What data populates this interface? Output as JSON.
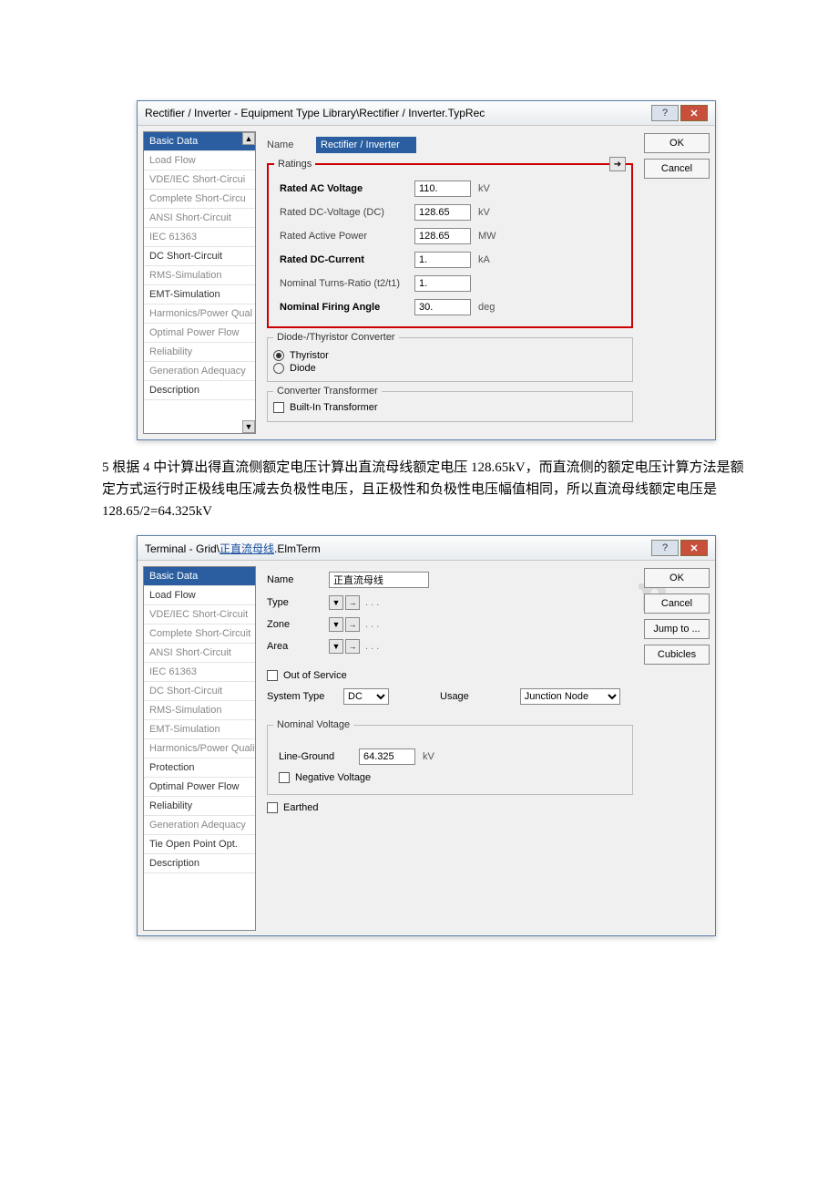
{
  "dialog1": {
    "title": "Rectifier / Inverter - Equipment Type Library\\Rectifier / Inverter.TypRec",
    "sidebar": [
      "Basic Data",
      "Load Flow",
      "VDE/IEC Short-Circui",
      "Complete Short-Circu",
      "ANSI Short-Circuit",
      "IEC 61363",
      "DC Short-Circuit",
      "RMS-Simulation",
      "EMT-Simulation",
      "Harmonics/Power Qual",
      "Optimal Power Flow",
      "Reliability",
      "Generation Adequacy",
      "Description"
    ],
    "name_label": "Name",
    "name_value": "Rectifier / Inverter",
    "ratings_legend": "Ratings",
    "ratings": [
      {
        "label": "Rated AC Voltage",
        "value": "110.",
        "unit": "kV",
        "hl": true
      },
      {
        "label": "Rated DC-Voltage (DC)",
        "value": "128.65",
        "unit": "kV",
        "hl": false
      },
      {
        "label": "Rated Active Power",
        "value": "128.65",
        "unit": "MW",
        "hl": false
      },
      {
        "label": "Rated DC-Current",
        "value": "1.",
        "unit": "kA",
        "hl": true
      },
      {
        "label": "Nominal Turns-Ratio (t2/t1)",
        "value": "1.",
        "unit": "",
        "hl": false
      },
      {
        "label": "Nominal Firing Angle",
        "value": "30.",
        "unit": "deg",
        "hl": true
      }
    ],
    "conv_legend": "Diode-/Thyristor Converter",
    "conv_opt1": "Thyristor",
    "conv_opt2": "Diode",
    "xfmr_legend": "Converter Transformer",
    "xfmr_check": "Built-In Transformer",
    "buttons": {
      "ok": "OK",
      "cancel": "Cancel"
    }
  },
  "doctext": "5 根据 4 中计算出得直流侧额定电压计算出直流母线额定电压 128.65kV，而直流侧的额定电压计算方法是额定方式运行时正极线电压减去负极性电压，且正极性和负极性电压幅值相同，所以直流母线额定电压是 128.65/2=64.325kV",
  "dialog2": {
    "title_pre": "Terminal - Grid\\",
    "title_link": "正直流母线",
    "title_post": ".ElmTerm",
    "watermark": "WWW.docx.com",
    "sidebar": [
      "Basic Data",
      "Load Flow",
      "VDE/IEC Short-Circuit",
      "Complete Short-Circuit",
      "ANSI Short-Circuit",
      "IEC 61363",
      "DC Short-Circuit",
      "RMS-Simulation",
      "EMT-Simulation",
      "Harmonics/Power Quality",
      "Protection",
      "Optimal Power Flow",
      "Reliability",
      "Generation Adequacy",
      "Tie Open Point Opt.",
      "Description"
    ],
    "name_label": "Name",
    "name_value": "正直流母线",
    "type_label": "Type",
    "zone_label": "Zone",
    "area_label": "Area",
    "triplet_dots": ". . .",
    "oos": "Out of Service",
    "systype_label": "System Type",
    "systype_value": "DC",
    "usage_label": "Usage",
    "usage_value": "Junction Node",
    "nomv_legend": "Nominal Voltage",
    "lg_label": "Line-Ground",
    "lg_value": "64.325",
    "lg_unit": "kV",
    "negv": "Negative Voltage",
    "earthed": "Earthed",
    "buttons": {
      "ok": "OK",
      "cancel": "Cancel",
      "jump": "Jump to ...",
      "cub": "Cubicles"
    }
  }
}
